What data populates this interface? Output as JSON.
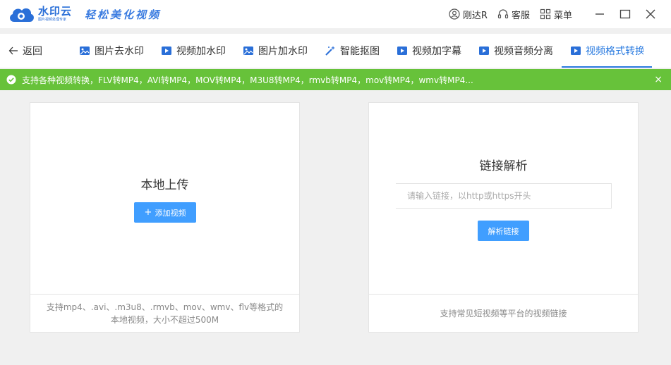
{
  "app": {
    "logo_name": "水印云",
    "logo_sub": "图片视频处理专家",
    "slogan": "轻松美化视频"
  },
  "titlebar": {
    "user_label": "刚达R",
    "service_label": "客服",
    "menu_label": "菜单"
  },
  "nav": {
    "back_label": "返回",
    "tabs": [
      {
        "label": "图片去水印",
        "icon": "image-icon"
      },
      {
        "label": "视频加水印",
        "icon": "video-icon"
      },
      {
        "label": "图片加水印",
        "icon": "image-icon"
      },
      {
        "label": "智能抠图",
        "icon": "magic-wand-icon"
      },
      {
        "label": "视频加字幕",
        "icon": "video-icon"
      },
      {
        "label": "视频音频分离",
        "icon": "video-icon"
      },
      {
        "label": "视频格式转换",
        "icon": "video-format-icon",
        "active": true
      }
    ]
  },
  "banner": {
    "text": "支持各种视频转换，FLV转MP4，AVI转MP4，MOV转MP4，M3U8转MP4，rmvb转MP4，mov转MP4，wmv转MP4...",
    "close": "×"
  },
  "upload_card": {
    "title": "本地上传",
    "button_plus": "+",
    "button_label": "添加视频",
    "footer": "支持mp4、.avi、.m3u8、.rmvb、mov、wmv、flv等格式的本地视频，大小不超过500M"
  },
  "link_card": {
    "title": "链接解析",
    "input_placeholder": "请输入链接，以http或https开头",
    "button_label": "解析链接",
    "footer": "支持常见短视频等平台的视频链接"
  },
  "colors": {
    "accent": "#409eff",
    "tab_active": "#2a7be0",
    "banner_bg": "#67c23a",
    "logo": "#2a6fd8"
  }
}
